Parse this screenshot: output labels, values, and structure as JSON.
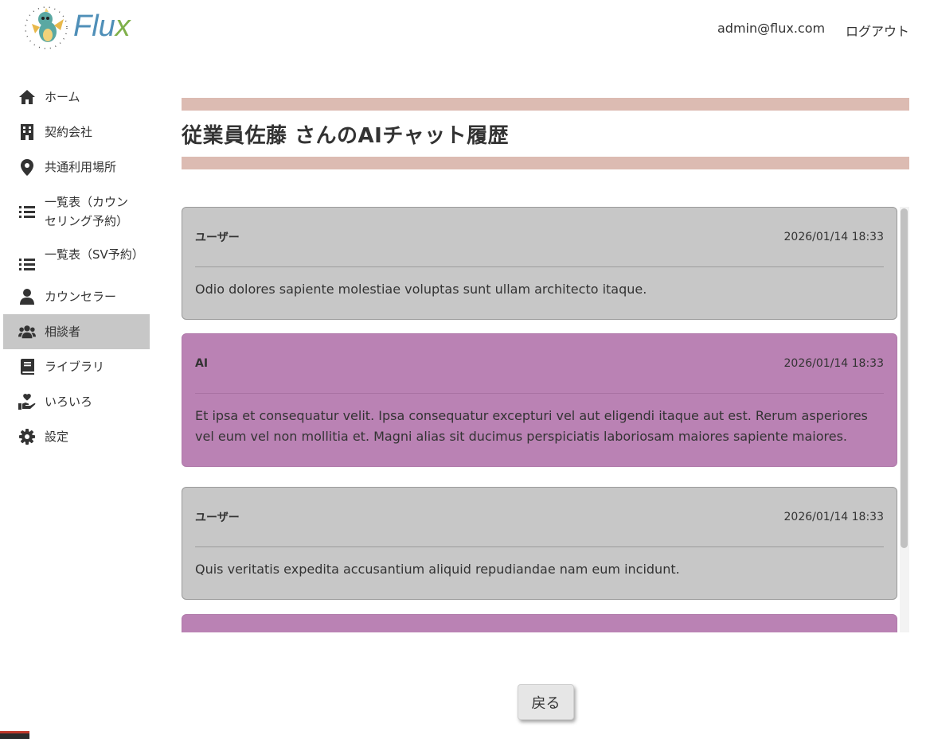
{
  "header": {
    "logo_text_main": "Flu",
    "logo_text_accent": "x",
    "user_email": "admin@flux.com",
    "logout_label": "ログアウト"
  },
  "sidebar": {
    "items": [
      {
        "label": "ホーム",
        "icon": "home-icon",
        "active": false
      },
      {
        "label": "契約会社",
        "icon": "building-icon",
        "active": false
      },
      {
        "label": "共通利用場所",
        "icon": "location-pin-icon",
        "active": false
      },
      {
        "label": "一覧表（カウンセリング予約）",
        "icon": "list-icon",
        "active": false
      },
      {
        "label": "一覧表（SV予約）",
        "icon": "list-icon",
        "active": false
      },
      {
        "label": "カウンセラー",
        "icon": "person-icon",
        "active": false
      },
      {
        "label": "相談者",
        "icon": "people-icon",
        "active": true
      },
      {
        "label": "ライブラリ",
        "icon": "book-icon",
        "active": false
      },
      {
        "label": "いろいろ",
        "icon": "hand-heart-icon",
        "active": false
      },
      {
        "label": "設定",
        "icon": "gear-icon",
        "active": false
      }
    ]
  },
  "main": {
    "title": "従業員佐藤 さんのAIチャット履歴",
    "messages": [
      {
        "role": "ユーザー",
        "type": "user",
        "time": "2026/01/14 18:33",
        "text": "Odio dolores sapiente molestiae voluptas sunt ullam architecto itaque."
      },
      {
        "role": "AI",
        "type": "ai",
        "time": "2026/01/14 18:33",
        "text": "Et ipsa et consequatur velit. Ipsa consequatur excepturi vel aut eligendi itaque aut est. Rerum asperiores vel eum vel non mollitia et. Magni alias sit ducimus perspiciatis laboriosam maiores sapiente maiores."
      },
      {
        "role": "ユーザー",
        "type": "user",
        "time": "2026/01/14 18:33",
        "text": "Quis veritatis expedita accusantium aliquid repudiandae nam eum incidunt."
      }
    ],
    "back_label": "戻る"
  },
  "colors": {
    "title_band": "#dcbbb2",
    "user_bubble": "#c7c7c7",
    "ai_bubble": "#ba82b4",
    "active_nav": "#c7c7c7"
  }
}
